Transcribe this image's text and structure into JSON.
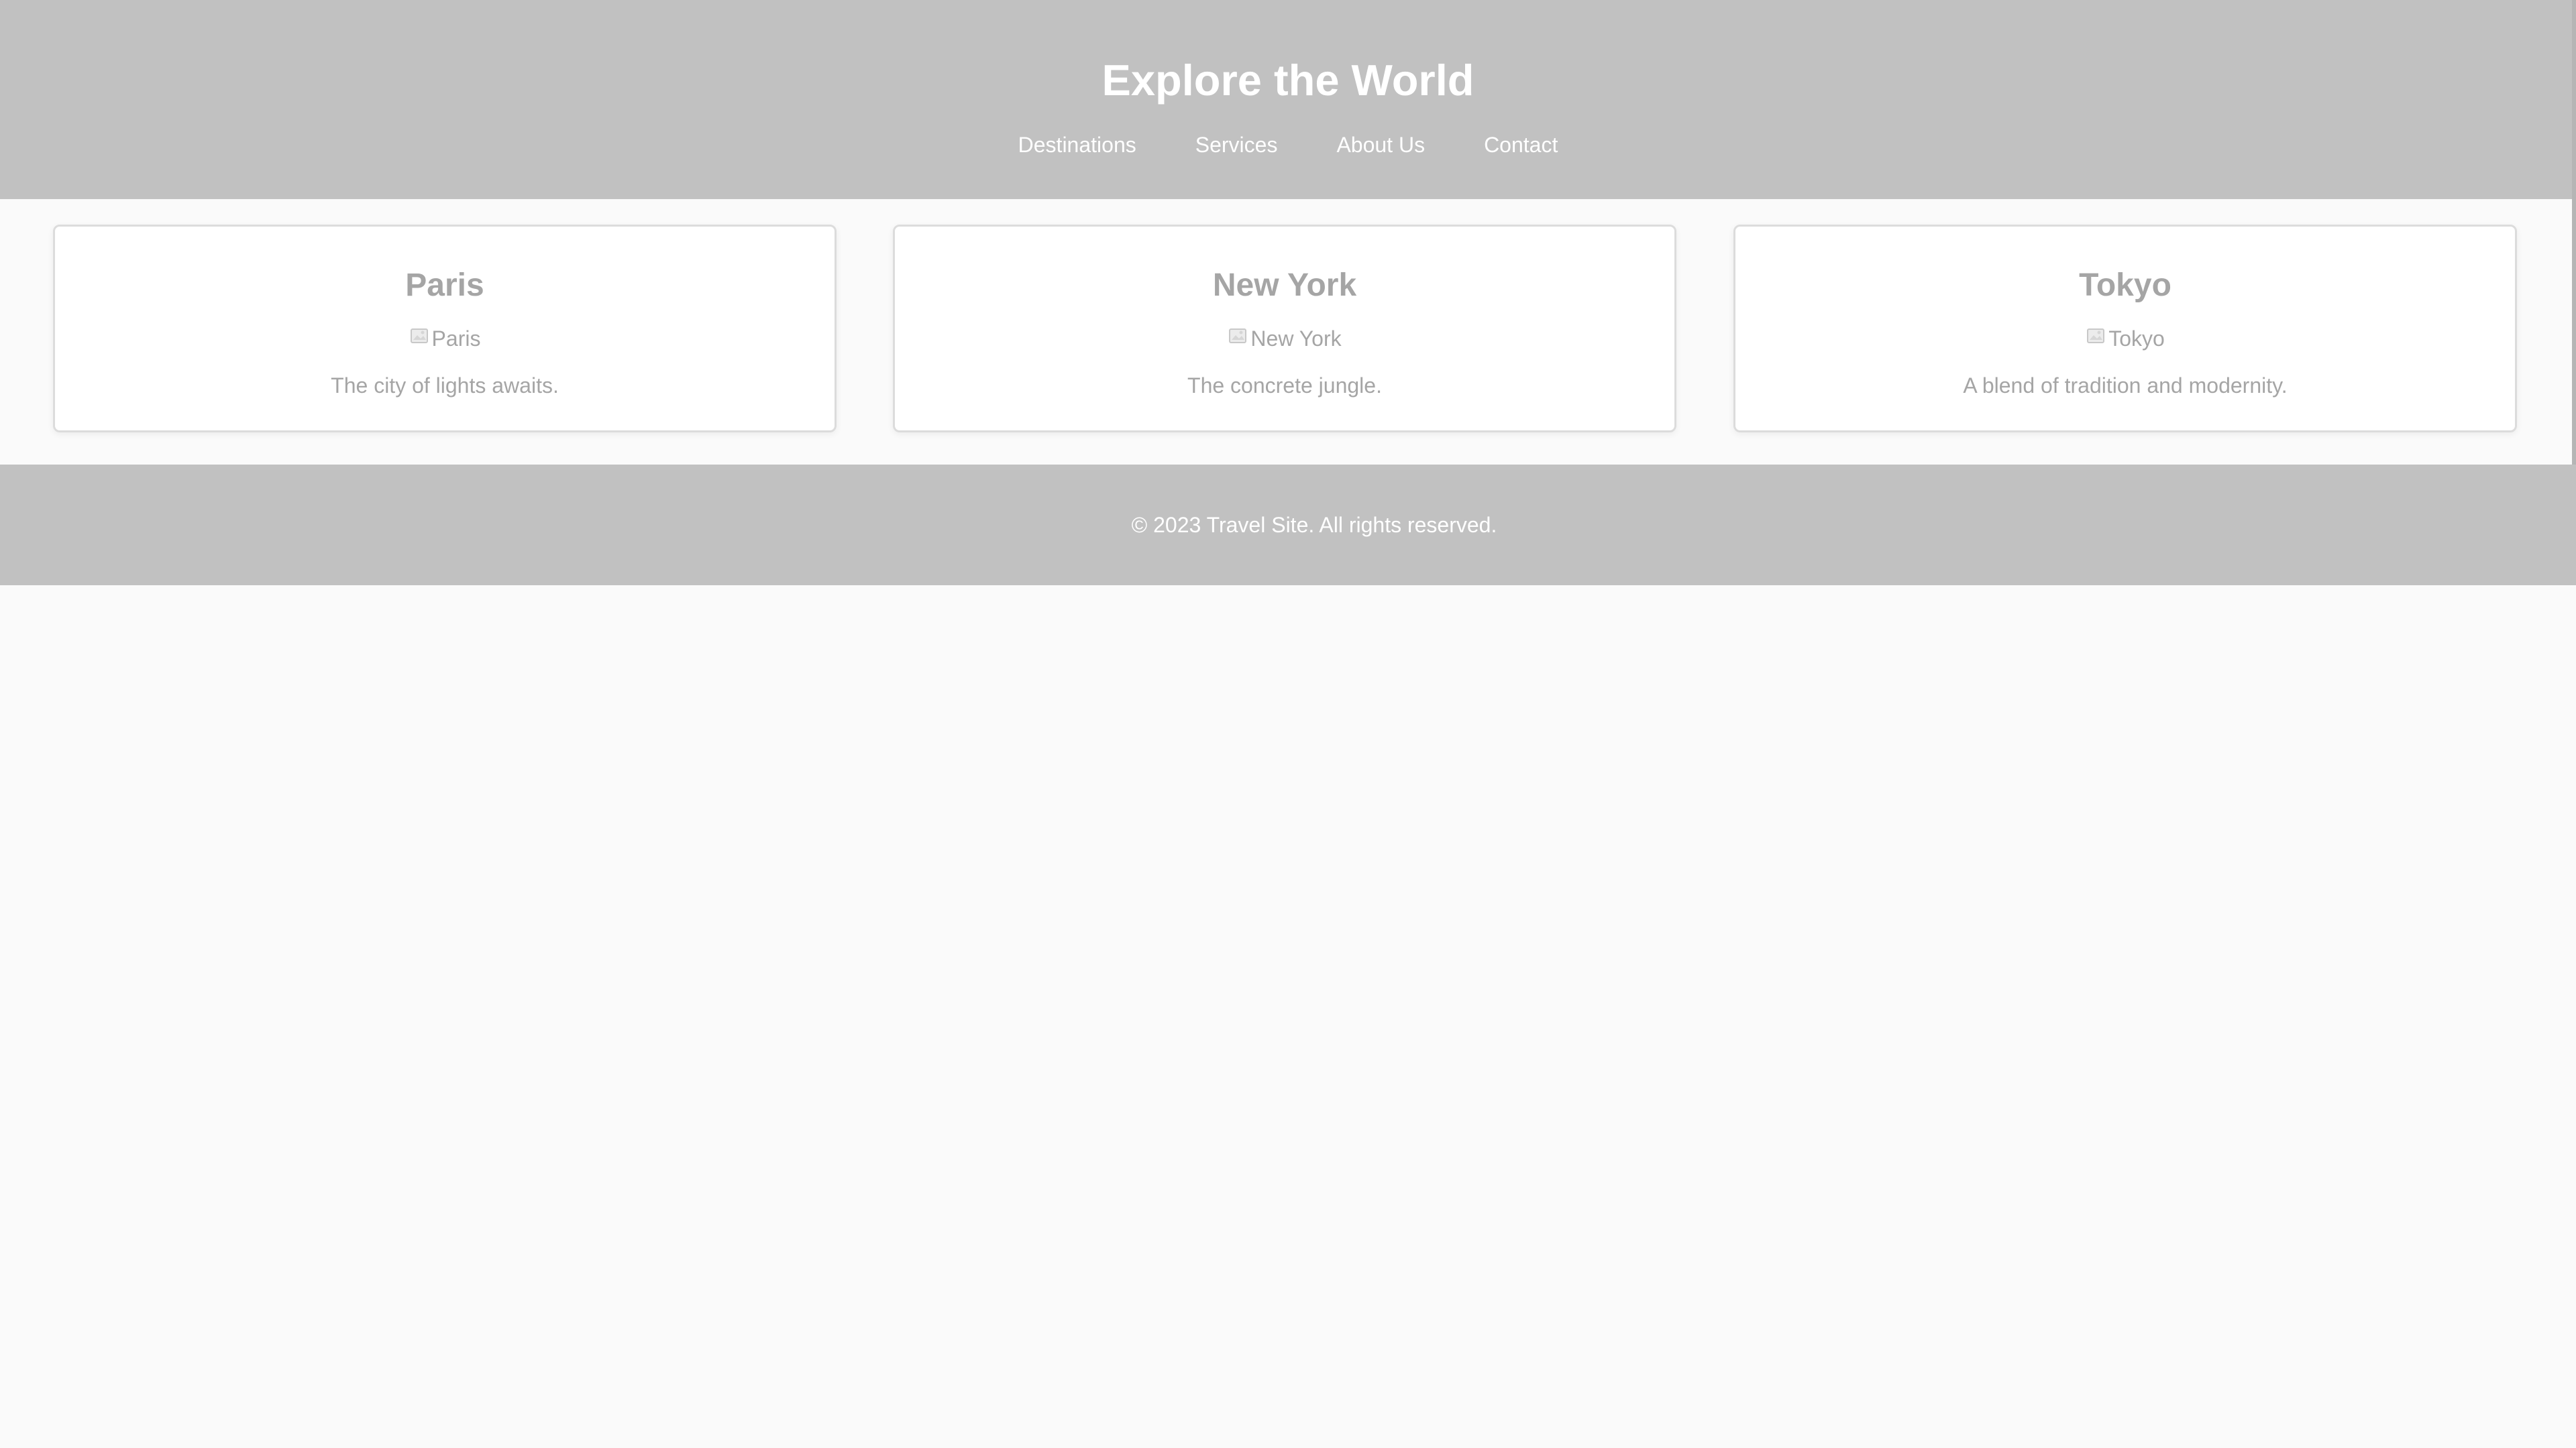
{
  "header": {
    "title": "Explore the World",
    "nav": [
      "Destinations",
      "Services",
      "About Us",
      "Contact"
    ]
  },
  "cards": [
    {
      "title": "Paris",
      "image_alt": "Paris",
      "description": "The city of lights awaits."
    },
    {
      "title": "New York",
      "image_alt": "New York",
      "description": "The concrete jungle."
    },
    {
      "title": "Tokyo",
      "image_alt": "Tokyo",
      "description": "A blend of tradition and modernity."
    }
  ],
  "footer": {
    "text": "© 2023 Travel Site. All rights reserved."
  },
  "colors": {
    "header_bg": "#c1c1c1",
    "page_bg": "#fafafa",
    "card_text": "#a5a5a5"
  }
}
